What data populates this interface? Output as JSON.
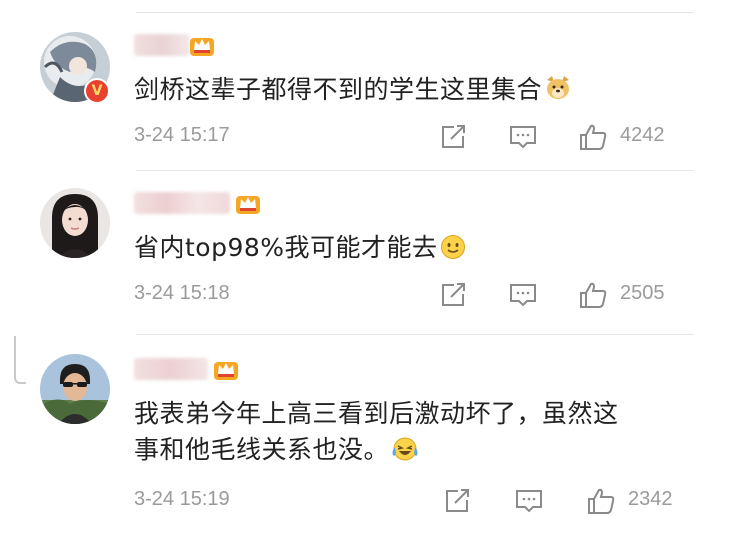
{
  "comments": [
    {
      "text_lines": [
        "剑桥这辈子都得不到的学生这里集合"
      ],
      "emoji": "doge-emoji",
      "time": "3-24 15:17",
      "likes": "4242",
      "verified_badge": "V"
    },
    {
      "text_lines": [
        "省内top98%我可能才能去"
      ],
      "emoji": "smile-emoji",
      "time": "3-24 15:18",
      "likes": "2505"
    },
    {
      "text_lines": [
        "我表弟今年上高三看到后激动坏了，虽然这",
        "事和他毛线关系也没。"
      ],
      "emoji": "laugh-cry-emoji",
      "time": "3-24 15:19",
      "likes": "2342"
    }
  ],
  "icons": {
    "repost": "repost-icon",
    "comment": "comment-icon",
    "like": "thumbs-up-icon",
    "member": "crown-icon"
  },
  "colors": {
    "text": "#222222",
    "meta": "#9a9a9a",
    "crown": "#f5a623",
    "verified": "#e8412f",
    "divider": "#e6e6e6"
  }
}
